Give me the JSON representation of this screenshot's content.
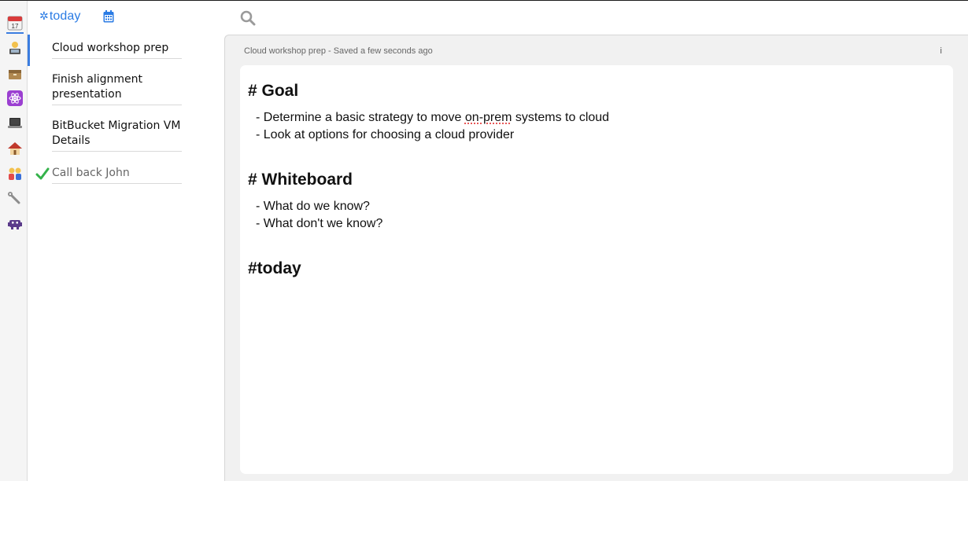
{
  "rail": {
    "items": [
      {
        "name": "calendar-17-icon",
        "glyph": "📅"
      },
      {
        "name": "person-laptop-icon",
        "glyph": "👨‍💻"
      },
      {
        "name": "box-icon",
        "glyph": "🗃"
      },
      {
        "name": "atom-icon",
        "glyph": "⚛"
      },
      {
        "name": "laptop-icon",
        "glyph": "💻"
      },
      {
        "name": "house-icon",
        "glyph": "🏠"
      },
      {
        "name": "couple-icon",
        "glyph": "👫"
      },
      {
        "name": "wrench-icon",
        "glyph": "🔧"
      },
      {
        "name": "alien-icon",
        "glyph": "👾"
      }
    ]
  },
  "list": {
    "tag_label": "today",
    "notes": [
      {
        "title": "Cloud workshop prep",
        "completed": false
      },
      {
        "title": "Finish alignment presentation",
        "completed": false
      },
      {
        "title": "BitBucket Migration VM Details",
        "completed": false
      },
      {
        "title": "Call back John",
        "completed": true
      }
    ]
  },
  "editor": {
    "status": "Cloud workshop prep - Saved a few seconds ago",
    "info_label": "i",
    "content": {
      "h1": "# Goal",
      "goal_items": [
        "- Determine a basic strategy to move ",
        "on-prem",
        " systems to cloud",
        "- Look at options for choosing a cloud provider"
      ],
      "h2": "# Whiteboard",
      "whiteboard_items": [
        "- What do we know?",
        "- What don't we know?"
      ],
      "tag": "#today"
    }
  },
  "colors": {
    "accent": "#3b7de0",
    "link": "#2a7be4",
    "check": "#34b24a"
  }
}
